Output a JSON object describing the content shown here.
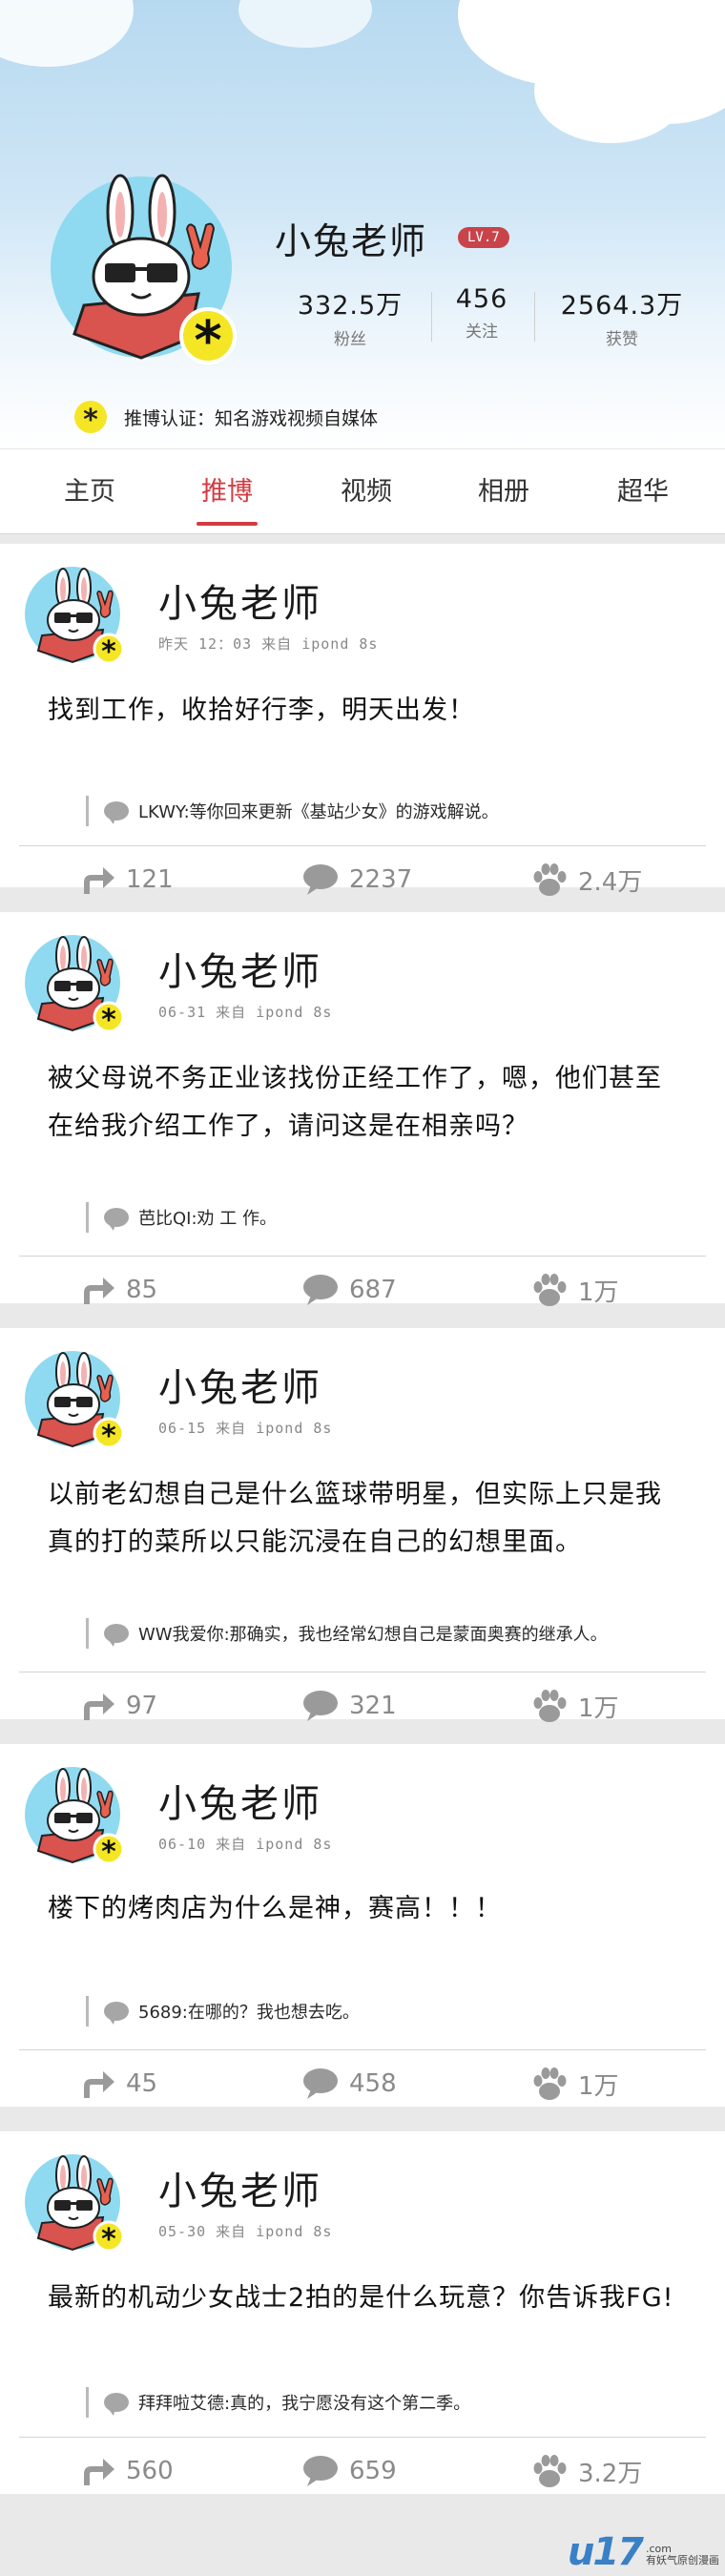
{
  "profile": {
    "name": "小兔老师",
    "level": "LV.7",
    "stats": [
      {
        "value": "332.5万",
        "label": "粉丝"
      },
      {
        "value": "456",
        "label": "关注"
      },
      {
        "value": "2564.3万",
        "label": "获赞"
      }
    ],
    "verification": "推博认证：知名游戏视频自媒体"
  },
  "tabs": [
    {
      "label": "主页",
      "active": false
    },
    {
      "label": "推博",
      "active": true
    },
    {
      "label": "视频",
      "active": false
    },
    {
      "label": "相册",
      "active": false
    },
    {
      "label": "超华",
      "active": false
    }
  ],
  "posts": [
    {
      "author": "小兔老师",
      "meta": "昨天 12：03 来自 ipond 8s",
      "text_lines": [
        "找到工作，收拾好行李，明天出发！"
      ],
      "reply": "LKWY:等你回来更新《基站少女》的游戏解说。",
      "reposts": "121",
      "comments": "2237",
      "likes": "2.4万"
    },
    {
      "author": "小兔老师",
      "meta": "06-31 来自 ipond 8s",
      "text_lines": [
        "被父母说不务正业该找份正经工作了，嗯，他们甚至",
        "在给我介绍工作了，请问这是在相亲吗？"
      ],
      "reply": "芭比QI:劝 工 作。",
      "reposts": "85",
      "comments": "687",
      "likes": "1万"
    },
    {
      "author": "小兔老师",
      "meta": "06-15 来自 ipond 8s",
      "text_lines": [
        "以前老幻想自己是什么篮球带明星，但实际上只是我",
        "真的打的菜所以只能沉浸在自己的幻想里面。"
      ],
      "reply": "WW我爱你:那确实，我也经常幻想自己是蒙面奥赛的继承人。",
      "reposts": "97",
      "comments": "321",
      "likes": "1万"
    },
    {
      "author": "小兔老师",
      "meta": "06-10 来自 ipond 8s",
      "text_lines": [
        "楼下的烤肉店为什么是神，赛高！！！"
      ],
      "reply": "5689:在哪的？我也想去吃。",
      "reposts": "45",
      "comments": "458",
      "likes": "1万"
    },
    {
      "author": "小兔老师",
      "meta": "05-30 来自 ipond 8s",
      "text_lines": [
        "最新的机动少女战士2拍的是什么玩意？你告诉我FG!"
      ],
      "reply": "拜拜啦艾德:真的，我宁愿没有这个第二季。",
      "reposts": "560",
      "comments": "659",
      "likes": "3.2万"
    }
  ],
  "watermark": {
    "logo": "u17",
    "sub_top": ".com",
    "sub_bottom": "有妖气原创漫画"
  },
  "colors": {
    "accent": "#d33b41",
    "badge_yellow": "#f5e625",
    "avatar_bg": "#8fdaf0",
    "scarf": "#d9534f"
  }
}
